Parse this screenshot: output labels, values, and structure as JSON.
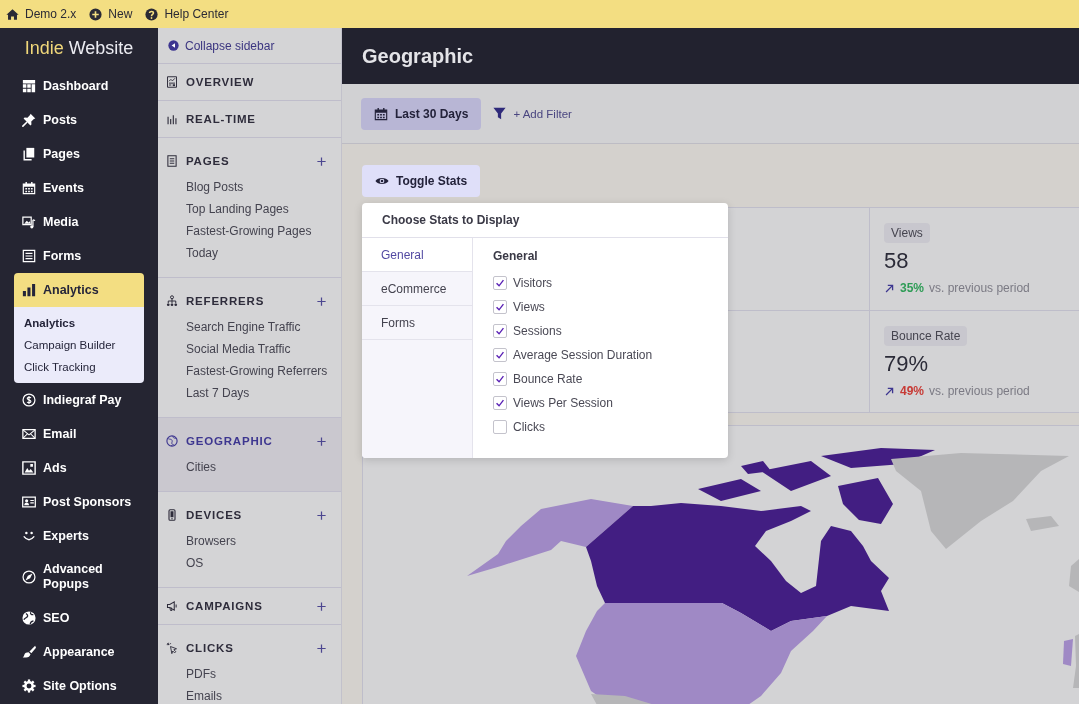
{
  "top_bar": [
    "Demo 2.x",
    "New",
    "Help Center"
  ],
  "brand": {
    "accent": "Indie",
    "rest": "Website"
  },
  "nav": [
    {
      "label": "Dashboard",
      "selected": false
    },
    {
      "label": "Posts",
      "selected": false
    },
    {
      "label": "Pages",
      "selected": false
    },
    {
      "label": "Events",
      "selected": false
    },
    {
      "label": "Media",
      "selected": false
    },
    {
      "label": "Forms",
      "selected": false
    },
    {
      "label": "Analytics",
      "selected": true,
      "children": [
        {
          "label": "Analytics",
          "selected": true
        },
        {
          "label": "Campaign Builder",
          "selected": false
        },
        {
          "label": "Click Tracking",
          "selected": false
        }
      ]
    },
    {
      "label": "Indiegraf Pay",
      "selected": false
    },
    {
      "label": "Email",
      "selected": false
    },
    {
      "label": "Ads",
      "selected": false
    },
    {
      "label": "Post Sponsors",
      "selected": false
    },
    {
      "label": "Experts",
      "selected": false
    },
    {
      "label": "Advanced Popups",
      "selected": false
    },
    {
      "label": "SEO",
      "selected": false
    },
    {
      "label": "Appearance",
      "selected": false
    },
    {
      "label": "Site Options",
      "selected": false
    }
  ],
  "subnav": {
    "collapse": "Collapse sidebar",
    "sections": [
      {
        "title": "OVERVIEW",
        "addable": false,
        "selected": false
      },
      {
        "title": "REAL-TIME",
        "addable": false,
        "selected": false
      },
      {
        "title": "PAGES",
        "addable": true,
        "selected": false,
        "items": [
          "Blog Posts",
          "Top Landing Pages",
          "Fastest-Growing Pages",
          "Today"
        ]
      },
      {
        "title": "REFERRERS",
        "addable": true,
        "selected": false,
        "items": [
          "Search Engine Traffic",
          "Social Media Traffic",
          "Fastest-Growing Referrers",
          "Last 7 Days"
        ]
      },
      {
        "title": "GEOGRAPHIC",
        "addable": true,
        "selected": true,
        "items": [
          "Cities"
        ]
      },
      {
        "title": "DEVICES",
        "addable": true,
        "selected": false,
        "items": [
          "Browsers",
          "OS"
        ]
      },
      {
        "title": "CAMPAIGNS",
        "addable": true,
        "selected": false
      },
      {
        "title": "CLICKS",
        "addable": true,
        "selected": false,
        "items": [
          "PDFs",
          "Emails"
        ]
      }
    ]
  },
  "page": {
    "title": "Geographic"
  },
  "toolbar": {
    "date_range": "Last 30 Days",
    "add_filter": "+ Add Filter"
  },
  "toggle_stats": "Toggle Stats",
  "stats_popup": {
    "title": "Choose Stats to Display",
    "tabs": [
      {
        "label": "General",
        "selected": true
      },
      {
        "label": "eCommerce",
        "selected": false
      },
      {
        "label": "Forms",
        "selected": false
      }
    ],
    "heading": "General",
    "options": [
      {
        "label": "Visitors",
        "checked": true
      },
      {
        "label": "Views",
        "checked": true
      },
      {
        "label": "Sessions",
        "checked": true
      },
      {
        "label": "Average Session Duration",
        "checked": true
      },
      {
        "label": "Bounce Rate",
        "checked": true
      },
      {
        "label": "Views Per Session",
        "checked": true
      },
      {
        "label": "Clicks",
        "checked": false
      }
    ]
  },
  "stat_cards": [
    {
      "label": "Views",
      "value": "58",
      "rising": true,
      "change": "35%",
      "favorable": true,
      "note": "vs. previous period"
    },
    {
      "label": "Bounce Rate",
      "value": "79%",
      "rising": true,
      "change": "49%",
      "favorable": false,
      "note": "vs. previous period"
    }
  ]
}
